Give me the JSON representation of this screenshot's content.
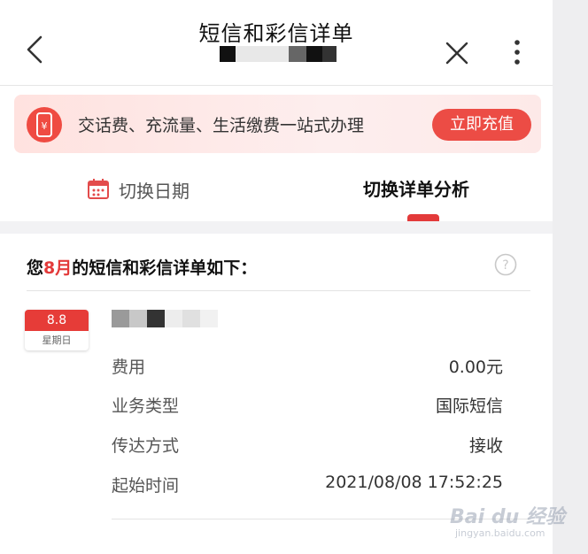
{
  "header": {
    "title": "短信和彩信详单",
    "back_icon": "chevron-left-icon",
    "close_icon": "close-icon",
    "more_icon": "more-vertical-icon"
  },
  "banner": {
    "icon": "phone-yuan-icon",
    "text": "交话费、充流量、生活缴费一站式办理",
    "button_label": "立即充值"
  },
  "tabs": {
    "date_label": "切换日期",
    "date_icon": "calendar-icon",
    "analysis_label": "切换详单分析"
  },
  "section": {
    "title_prefix": "您",
    "title_month": "8月",
    "title_suffix": "的短信和彩信详单如下：",
    "help_icon": "question-circle-icon"
  },
  "record": {
    "date": "8.8",
    "weekday": "星期日",
    "rows": [
      {
        "label": "费用",
        "value": "0.00元"
      },
      {
        "label": "业务类型",
        "value": "国际短信"
      },
      {
        "label": "传达方式",
        "value": "接收"
      },
      {
        "label": "起始时间",
        "value": "2021/08/08 17:52:25"
      }
    ]
  },
  "watermark": {
    "main": "Bai du 经验",
    "sub": "jingyan.baidu.com"
  },
  "colors": {
    "accent": "#e33a3a",
    "button": "#ec4c45",
    "banner_bg": "#ffe2df"
  }
}
